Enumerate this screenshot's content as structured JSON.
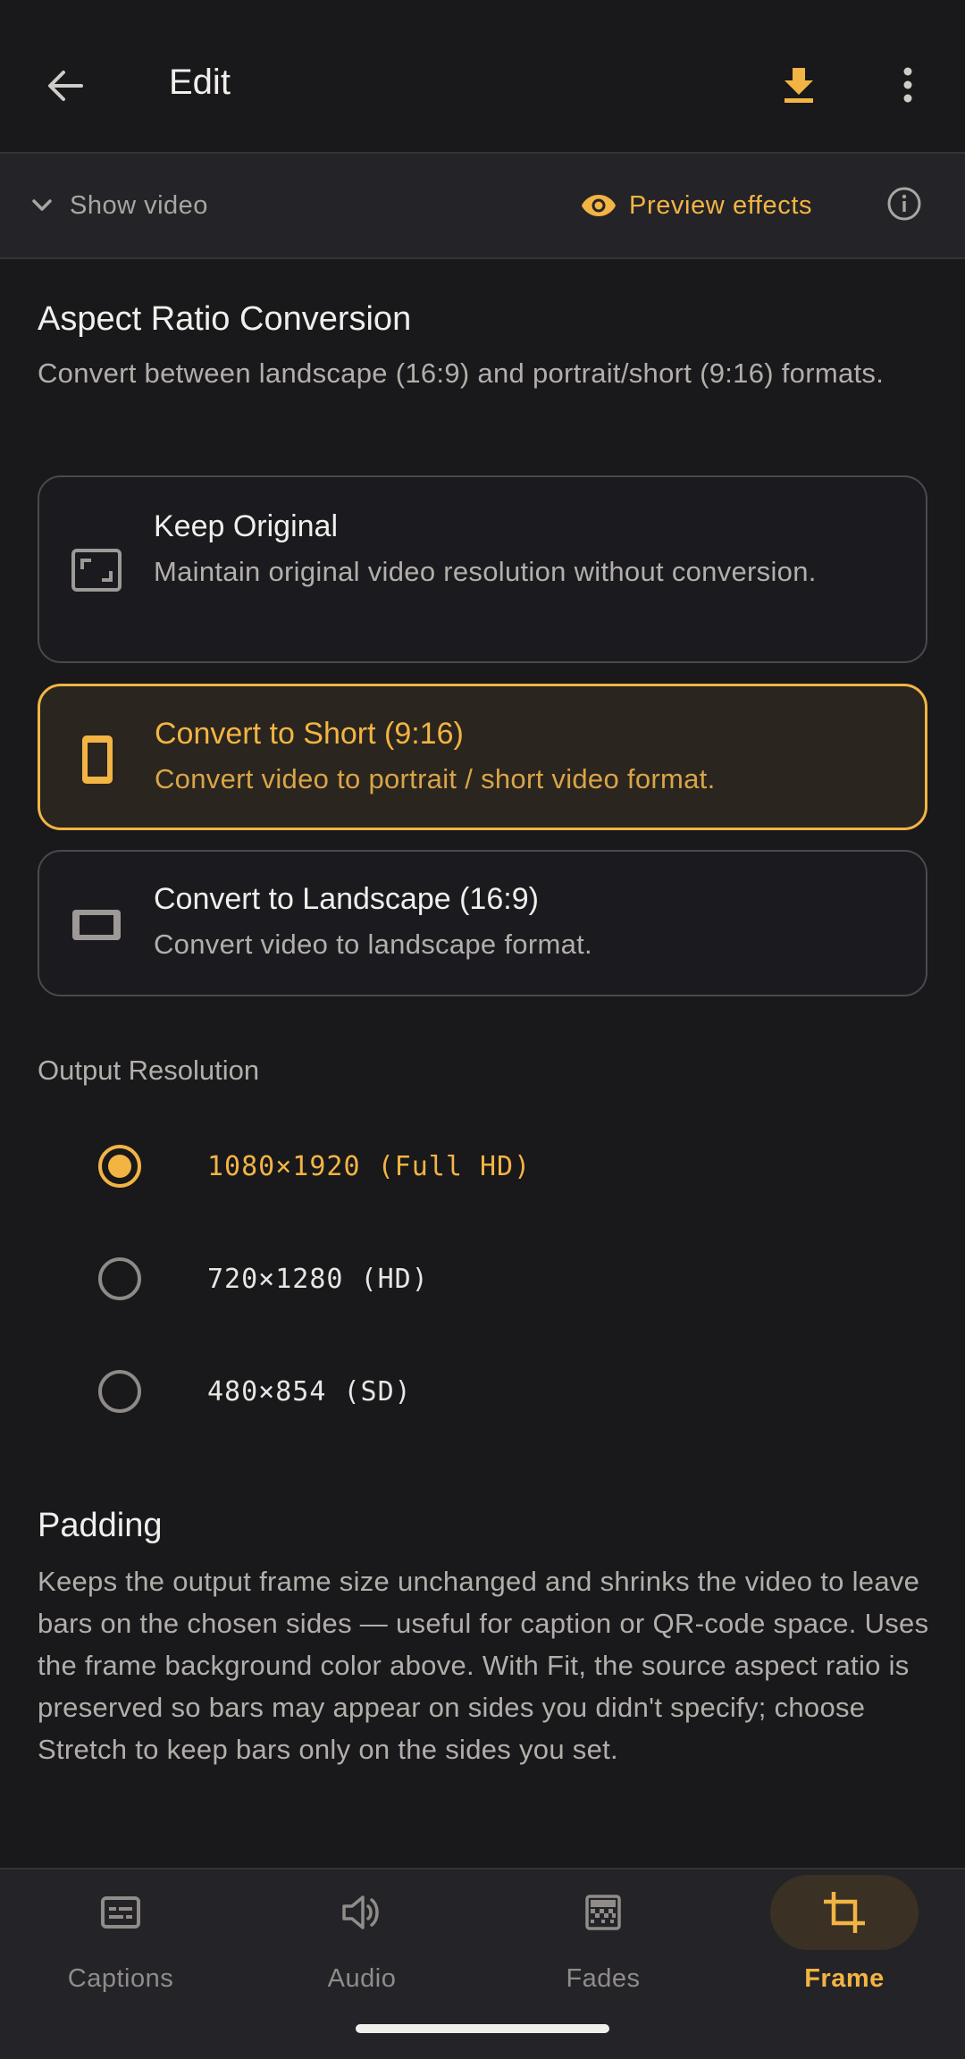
{
  "appbar": {
    "title": "Edit"
  },
  "toolbar": {
    "show_video_label": "Show video",
    "preview_label": "Preview effects"
  },
  "aspect": {
    "heading": "Aspect Ratio Conversion",
    "description": "Convert between landscape (16:9) and portrait/short (9:16) formats.",
    "options": [
      {
        "title": "Keep Original",
        "subtitle": "Maintain original video resolution without conversion.",
        "icon": "aspect-ratio-icon",
        "selected": false
      },
      {
        "title": "Convert to Short (9:16)",
        "subtitle": "Convert video to portrait / short video format.",
        "icon": "phone-portrait-icon",
        "selected": true
      },
      {
        "title": "Convert to Landscape (16:9)",
        "subtitle": "Convert video to landscape format.",
        "icon": "landscape-icon",
        "selected": false
      }
    ]
  },
  "resolution": {
    "heading": "Output Resolution",
    "options": [
      {
        "label": "1080×1920 (Full HD)",
        "selected": true
      },
      {
        "label": "720×1280 (HD)",
        "selected": false
      },
      {
        "label": "480×854 (SD)",
        "selected": false
      }
    ]
  },
  "padding": {
    "heading": "Padding",
    "description": "Keeps the output frame size unchanged and shrinks the video to leave bars on the chosen sides — useful for caption or QR-code space. Uses the frame background color above. With Fit, the source aspect ratio is preserved so bars may appear on sides you didn't specify; choose Stretch to keep bars only on the sides you set."
  },
  "nav": {
    "items": [
      {
        "label": "Captions",
        "icon": "captions-icon",
        "active": false
      },
      {
        "label": "Audio",
        "icon": "speaker-icon",
        "active": false
      },
      {
        "label": "Fades",
        "icon": "fades-icon",
        "active": false
      },
      {
        "label": "Frame",
        "icon": "crop-icon",
        "active": true
      }
    ]
  },
  "colors": {
    "accent": "#f2b443",
    "background": "#19181b",
    "surface": "#242327"
  }
}
